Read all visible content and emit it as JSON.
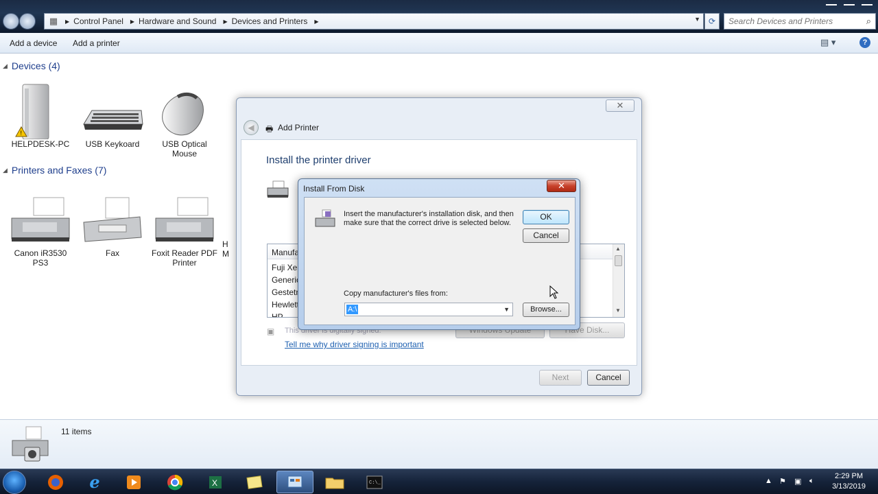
{
  "explorer": {
    "breadcrumbs": [
      "Control Panel",
      "Hardware and Sound",
      "Devices and Printers"
    ],
    "search_placeholder": "Search Devices and Printers",
    "commands": {
      "add_device": "Add a device",
      "add_printer": "Add a printer"
    },
    "groups": {
      "devices": {
        "header": "Devices (4)",
        "items": [
          {
            "label": "HELPDESK-PC",
            "icon": "computer-warning-icon"
          },
          {
            "label": "USB Keykoard",
            "icon": "keyboard-icon"
          },
          {
            "label": "USB Optical Mouse",
            "icon": "mouse-icon"
          }
        ]
      },
      "printers": {
        "header": "Printers and Faxes (7)",
        "items": [
          {
            "label": "Canon iR3530 PS3",
            "icon": "printer-icon"
          },
          {
            "label": "Fax",
            "icon": "fax-icon"
          },
          {
            "label": "Foxit Reader PDF Printer",
            "icon": "printer-icon"
          },
          {
            "label": "H M",
            "icon": "printer-icon"
          }
        ]
      }
    },
    "details": {
      "count": "11 items"
    }
  },
  "wizard": {
    "title": "Add Printer",
    "heading": "Install the printer driver",
    "list_header": "Manufa",
    "list_items": [
      "Fuji Xer",
      "Generic",
      "Gestetn",
      "Hewlett",
      "HP"
    ],
    "signed_text": "This driver is digitally signed.",
    "link": "Tell me why driver signing is important",
    "windows_update": "Windows Update",
    "have_disk": "Have Disk...",
    "next": "Next",
    "cancel": "Cancel"
  },
  "install_from_disk": {
    "title": "Install From Disk",
    "message": "Insert the manufacturer's installation disk, and then make sure that the correct drive is selected below.",
    "ok": "OK",
    "cancel": "Cancel",
    "copy_label": "Copy manufacturer's files from:",
    "path_value": "A:\\",
    "browse": "Browse..."
  },
  "taskbar": {
    "time": "2:29 PM",
    "date": "3/13/2019",
    "apps": [
      "firefox-icon",
      "internet-explorer-icon",
      "media-player-icon",
      "chrome-icon",
      "excel-icon",
      "sticky-notes-icon",
      "control-panel-icon",
      "file-explorer-icon",
      "command-prompt-icon"
    ]
  },
  "colors": {
    "accent": "#1e3e8c",
    "link": "#1c5fb0",
    "selection": "#3399ff",
    "close_red": "#c7412b"
  }
}
